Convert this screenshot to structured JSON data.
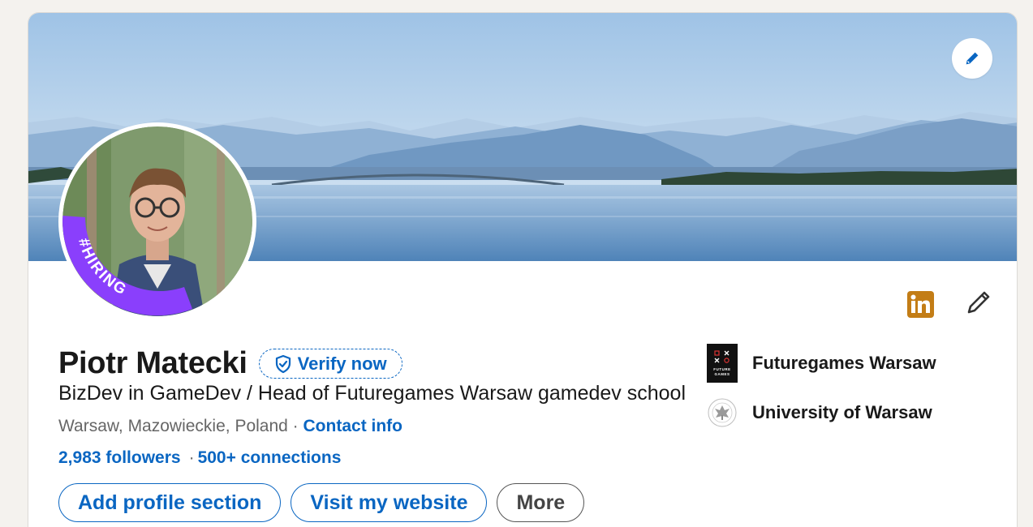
{
  "profile": {
    "name": "Piotr Matecki",
    "verify_label": "Verify now",
    "headline": "BizDev in GameDev / Head of Futuregames Warsaw gamedev school",
    "location": "Warsaw, Mazowieckie, Poland",
    "location_sep": " · ",
    "contact_info": "Contact info",
    "followers": "2,983 followers",
    "stats_sep": "·",
    "connections": "500+ connections",
    "avatar_frame_text": "#HIRING"
  },
  "actions": {
    "add_section": "Add profile section",
    "visit_website": "Visit my website",
    "more": "More"
  },
  "organizations": [
    {
      "name": "Futuregames Warsaw",
      "logo_text": "FUTURE GAMES"
    },
    {
      "name": "University of Warsaw"
    }
  ],
  "colors": {
    "link_blue": "#0a66c2",
    "linkedin_badge": "#c37d16",
    "hiring_frame": "#8a3ffc"
  },
  "icons": {
    "edit_banner": "pencil-icon",
    "verify": "shield-check-icon",
    "linkedin": "linkedin-icon",
    "edit_intro": "pencil-icon"
  }
}
